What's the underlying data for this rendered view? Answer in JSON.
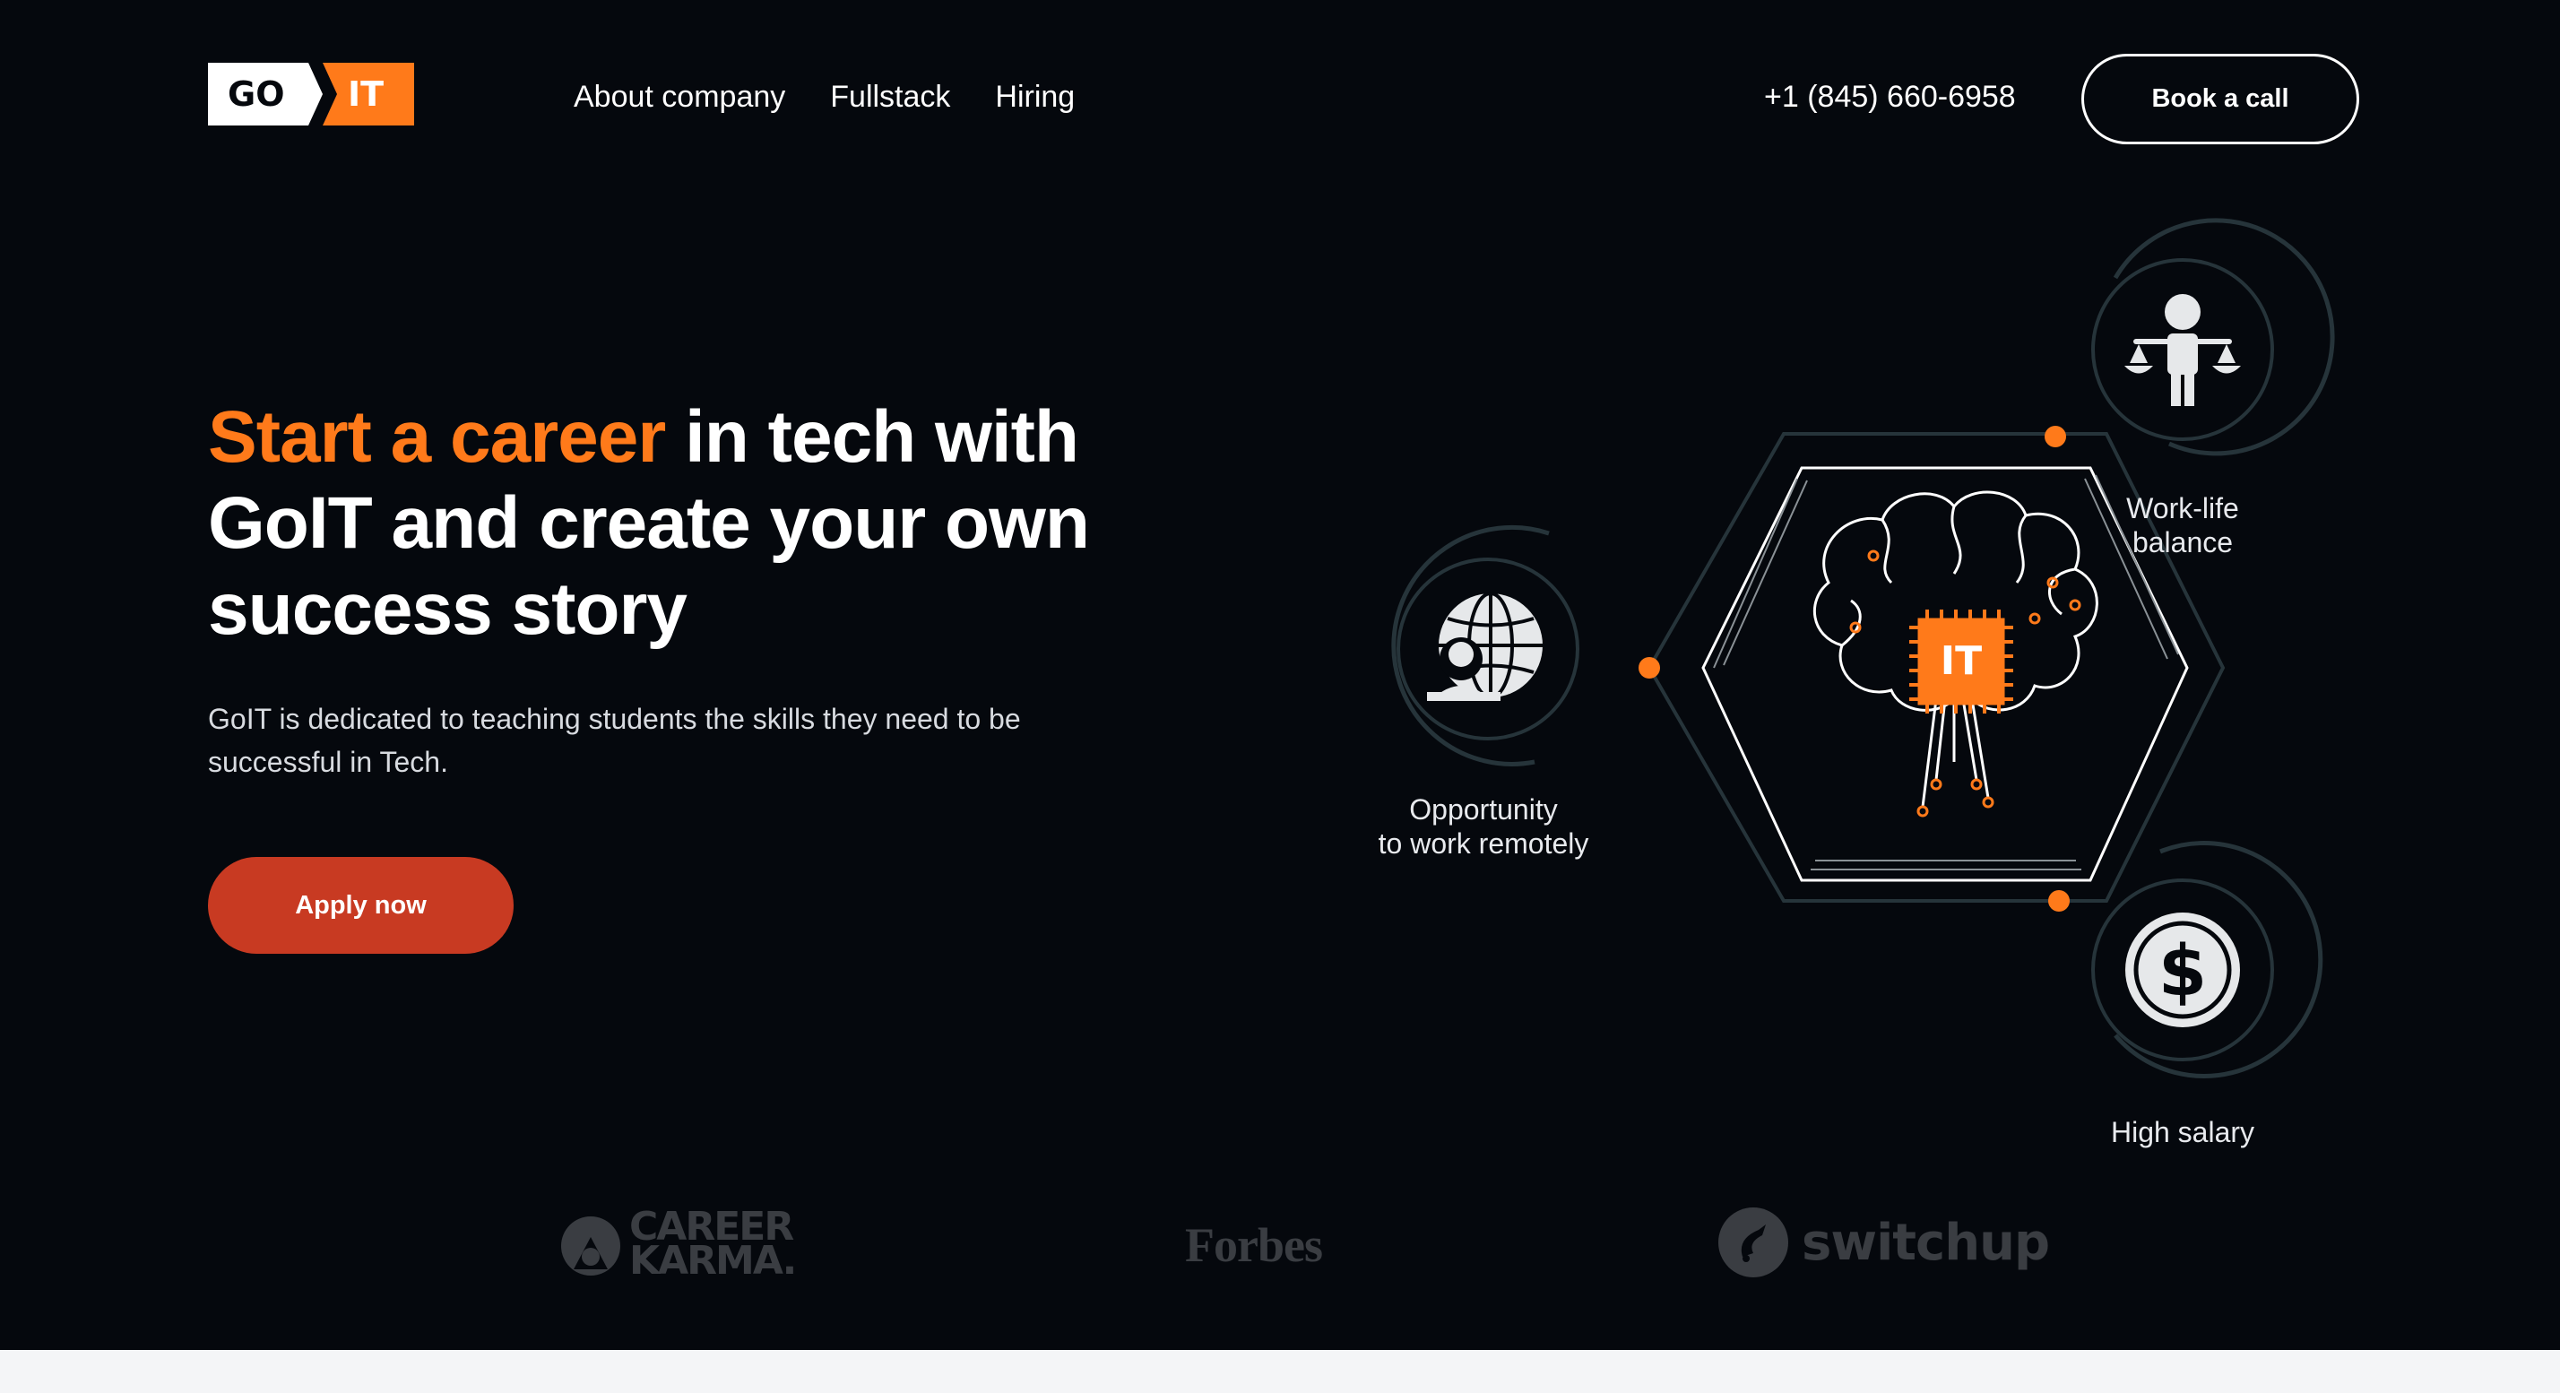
{
  "header": {
    "logo_left": "GO",
    "logo_right": "IT",
    "nav": [
      {
        "label": "About company"
      },
      {
        "label": "Fullstack"
      },
      {
        "label": "Hiring"
      }
    ],
    "phone": "+1 (845) 660-6958",
    "book_label": "Book a call"
  },
  "hero": {
    "headline_accent": "Start a career",
    "headline_rest_1": " in tech with",
    "headline_rest_2": "GoIT and create your own",
    "headline_rest_3": "success story",
    "subtext": "GoIT is dedicated to teaching students the skills they need to be successful in Tech.",
    "apply_label": "Apply now"
  },
  "illustration": {
    "chip_label": "IT",
    "features": [
      {
        "line1": "Work-life",
        "line2": "balance",
        "icon": "scales-person-icon"
      },
      {
        "line1": "Opportunity",
        "line2": "to work remotely",
        "icon": "globe-laptop-icon"
      },
      {
        "line1": "High salary",
        "line2": "",
        "icon": "dollar-coin-icon"
      }
    ]
  },
  "partners": {
    "career_karma_1": "CAREER",
    "career_karma_2": "KARMA.",
    "forbes": "Forbes",
    "switchup": "switchup"
  },
  "colors": {
    "background": "#05080d",
    "accent": "#ff7a1a",
    "apply": "#c83a22",
    "ring": "#2a3a40"
  }
}
